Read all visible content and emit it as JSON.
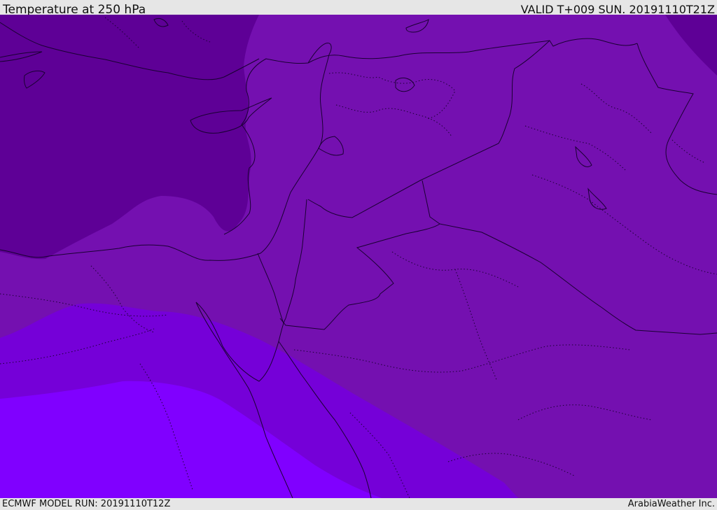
{
  "header": {
    "title": "Temperature at 250 hPa",
    "valid_time": "VALID T+009 SUN. 20191110T21Z"
  },
  "footer": {
    "model_run": "ECMWF MODEL RUN: 20191110T12Z",
    "credit": "ArabiaWeather Inc."
  },
  "map": {
    "field": "temperature",
    "level": "250 hPa",
    "shading_colors": [
      "#5e0096",
      "#7410b0",
      "#7500d8",
      "#8000ff"
    ]
  }
}
